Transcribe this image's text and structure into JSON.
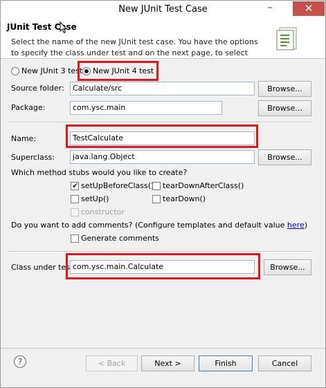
{
  "window": {
    "title": "New JUnit Test Case",
    "minimize": "–",
    "maximize": "☐",
    "close": "✕"
  },
  "header": {
    "title": "JUnit Test Case",
    "description": "Select the name of the new JUnit test case. You have the options to specify the class under test and on the next page, to select methods to be tested."
  },
  "version": {
    "junit3_label": "New JUnit 3 test",
    "junit4_label": "New JUnit 4 test",
    "selected": "junit4"
  },
  "source_folder": {
    "label": "Source folder:",
    "value": "Calculate/src",
    "browse": "Browse..."
  },
  "package": {
    "label": "Package:",
    "value": "com.ysc.main",
    "browse": "Browse..."
  },
  "name": {
    "label": "Name:",
    "value": "TestCalculate"
  },
  "superclass": {
    "label": "Superclass:",
    "value": "java.lang.Object",
    "browse": "Browse..."
  },
  "stubs": {
    "question": "Which method stubs would you like to create?",
    "setUpBeforeClass": {
      "label": "setUpBeforeClass()",
      "checked": true
    },
    "tearDownAfterClass": {
      "label": "tearDownAfterClass()",
      "checked": false
    },
    "setUp": {
      "label": "setUp()",
      "checked": false
    },
    "tearDown": {
      "label": "tearDown()",
      "checked": false
    },
    "constructor": {
      "label": "constructor",
      "checked": false,
      "enabled": false
    }
  },
  "comments": {
    "question_prefix": "Do you want to add comments? (Configure templates and default value ",
    "link": "here",
    "question_suffix": ")",
    "generate_label": "Generate comments",
    "checked": false
  },
  "class_under_test": {
    "label": "Class under test:",
    "value": "com.ysc.main.Calculate",
    "browse": "Browse..."
  },
  "footer": {
    "help": "?",
    "back": "< Back",
    "next": "Next >",
    "finish": "Finish",
    "cancel": "Cancel"
  },
  "colors": {
    "highlight": "#e8141b",
    "close": "#c7504c",
    "link": "#0000ee"
  }
}
